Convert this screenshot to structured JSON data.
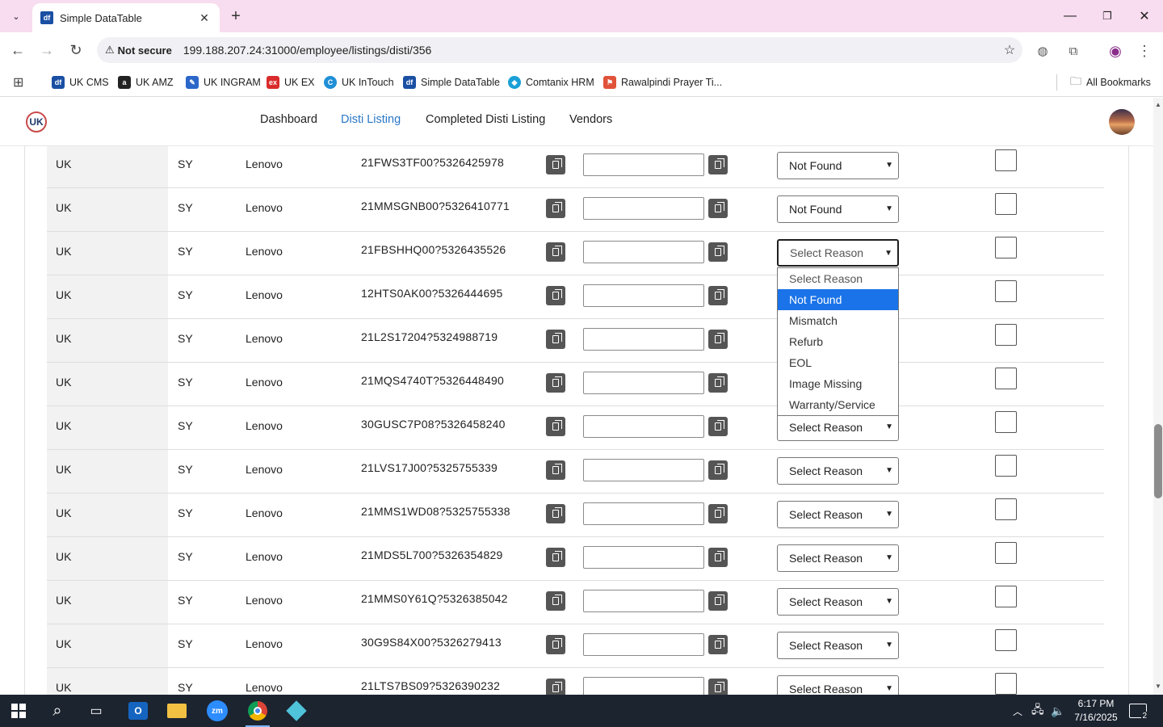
{
  "browser": {
    "tab_title": "Simple DataTable",
    "tab_favicon": "df",
    "url": "199.188.207.24:31000/employee/listings/disti/356",
    "security_label": "Not secure",
    "bookmarks": [
      {
        "label": "UK CMS",
        "color": "#1a4fa3",
        "glyph": "df"
      },
      {
        "label": "UK AMZ",
        "color": "#222222",
        "glyph": "a"
      },
      {
        "label": "UK INGRAM",
        "color": "#2b66c9",
        "glyph": "✎"
      },
      {
        "label": "UK EX",
        "color": "#d92b2b",
        "glyph": "ex"
      },
      {
        "label": "UK InTouch",
        "color": "#1f8fd6",
        "glyph": "C"
      },
      {
        "label": "Simple DataTable",
        "color": "#1a4fa3",
        "glyph": "df"
      },
      {
        "label": "Comtanix HRM",
        "color": "#1aa0d6",
        "glyph": "◆"
      },
      {
        "label": "Rawalpindi Prayer Ti...",
        "color": "#e0533a",
        "glyph": "⚑"
      }
    ],
    "all_bookmarks_label": "All Bookmarks"
  },
  "app": {
    "logo_text": "UK",
    "nav": [
      {
        "label": "Dashboard",
        "active": false
      },
      {
        "label": "Disti Listing",
        "active": true
      },
      {
        "label": "Completed Disti Listing",
        "active": false
      },
      {
        "label": "Vendors",
        "active": false
      }
    ]
  },
  "table": {
    "rows": [
      {
        "region": "UK",
        "code": "SY",
        "brand": "Lenovo",
        "sku": "21FWS3TF00?5326425978",
        "reason": "Not Found"
      },
      {
        "region": "UK",
        "code": "SY",
        "brand": "Lenovo",
        "sku": "21MMSGNB00?5326410771",
        "reason": "Not Found"
      },
      {
        "region": "UK",
        "code": "SY",
        "brand": "Lenovo",
        "sku": "21FBSHHQ00?5326435526",
        "reason": "Select Reason"
      },
      {
        "region": "UK",
        "code": "SY",
        "brand": "Lenovo",
        "sku": "12HTS0AK00?5326444695",
        "reason": "Select Reason"
      },
      {
        "region": "UK",
        "code": "SY",
        "brand": "Lenovo",
        "sku": "21L2S17204?5324988719",
        "reason": "Select Reason"
      },
      {
        "region": "UK",
        "code": "SY",
        "brand": "Lenovo",
        "sku": "21MQS4740T?5326448490",
        "reason": "Select Reason"
      },
      {
        "region": "UK",
        "code": "SY",
        "brand": "Lenovo",
        "sku": "30GUSC7P08?5326458240",
        "reason": "Select Reason"
      },
      {
        "region": "UK",
        "code": "SY",
        "brand": "Lenovo",
        "sku": "21LVS17J00?5325755339",
        "reason": "Select Reason"
      },
      {
        "region": "UK",
        "code": "SY",
        "brand": "Lenovo",
        "sku": "21MMS1WD08?5325755338",
        "reason": "Select Reason"
      },
      {
        "region": "UK",
        "code": "SY",
        "brand": "Lenovo",
        "sku": "21MDS5L700?5326354829",
        "reason": "Select Reason"
      },
      {
        "region": "UK",
        "code": "SY",
        "brand": "Lenovo",
        "sku": "21MMS0Y61Q?5326385042",
        "reason": "Select Reason"
      },
      {
        "region": "UK",
        "code": "SY",
        "brand": "Lenovo",
        "sku": "30G9S84X00?5326279413",
        "reason": "Select Reason"
      },
      {
        "region": "UK",
        "code": "SY",
        "brand": "Lenovo",
        "sku": "21LTS7BS09?5326390232",
        "reason": "Select Reason"
      }
    ],
    "open_dropdown_row": 2,
    "reason_options": [
      "Select Reason",
      "Not Found",
      "Mismatch",
      "Refurb",
      "EOL",
      "Image Missing",
      "Warranty/Service"
    ],
    "highlighted_option": "Not Found"
  },
  "taskbar": {
    "time": "6:17 PM",
    "date": "7/16/2025",
    "notification_count": "2"
  }
}
